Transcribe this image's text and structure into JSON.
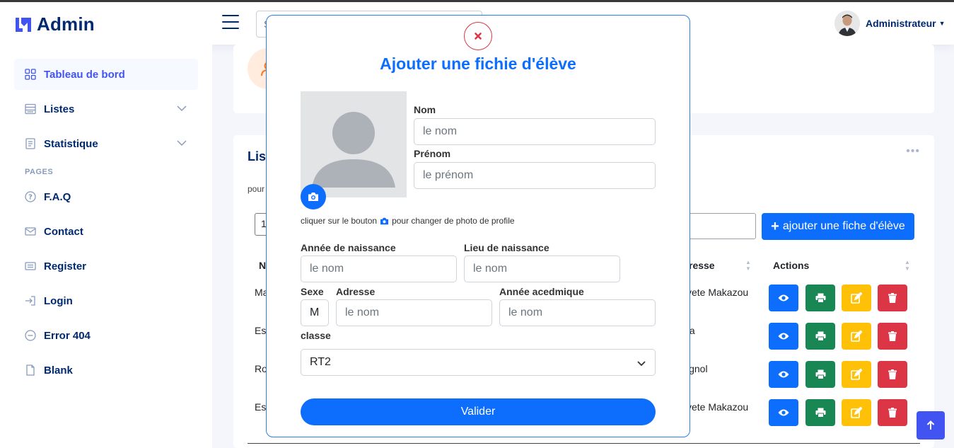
{
  "app": {
    "logo_text": "Admin"
  },
  "header": {
    "search_placeholder": "S",
    "profile_name": "Administrateur"
  },
  "sidebar": {
    "items": [
      {
        "label": "Tableau de bord",
        "icon": "grid-icon",
        "active": true
      },
      {
        "label": "Listes",
        "icon": "list-icon",
        "expandable": true
      },
      {
        "label": "Statistique",
        "icon": "document-icon",
        "expandable": true
      }
    ],
    "pages_heading": "PAGES",
    "pages": [
      {
        "label": "F.A.Q",
        "icon": "question-circle-icon"
      },
      {
        "label": "Contact",
        "icon": "envelope-icon"
      },
      {
        "label": "Register",
        "icon": "card-icon"
      },
      {
        "label": "Login",
        "icon": "login-arrow-icon"
      },
      {
        "label": "Error 404",
        "icon": "dash-circle-icon"
      },
      {
        "label": "Blank",
        "icon": "file-icon"
      }
    ]
  },
  "list_card": {
    "title_visible": "Lis",
    "subtitle_visible": "pour",
    "entries_visible": "1",
    "add_button": "ajouter une fiche d'élève",
    "columns": {
      "first_visible": "N",
      "address_visible": "resse",
      "actions": "Actions"
    },
    "rows": [
      {
        "first_visible": "Ma",
        "address_visible": "yete Makazou"
      },
      {
        "first_visible": "Es",
        "address_visible": "ta"
      },
      {
        "first_visible": "Ro",
        "address_visible": "ignol"
      },
      {
        "first_visible": "Es",
        "address_visible": "yete Makazou"
      }
    ]
  },
  "modal": {
    "title": "Ajouter une fichie d'élève",
    "nom_label": "Nom",
    "nom_placeholder": "le nom",
    "prenom_label": "Prénom",
    "prenom_placeholder": "le prénom",
    "photo_hint_before": "cliquer sur le bouton",
    "photo_hint_after": "pour changer de photo de profile",
    "annee_label": "Année de naissance",
    "annee_placeholder": "le nom",
    "lieu_label": "Lieu de naissance",
    "lieu_placeholder": "le nom",
    "sexe_label": "Sexe",
    "sexe_value": "M",
    "adresse_label": "Adresse",
    "adresse_placeholder": "le nom",
    "annee_acad_label": "Année acedmique",
    "annee_acad_placeholder": "le nom",
    "classe_label": "classe",
    "classe_value": "RT2",
    "submit_label": "Valider"
  },
  "colors": {
    "primary": "#0d6efd",
    "brand": "#4154f1",
    "navy": "#012970",
    "success": "#198754",
    "warning": "#ffc107",
    "danger": "#dc3545"
  }
}
